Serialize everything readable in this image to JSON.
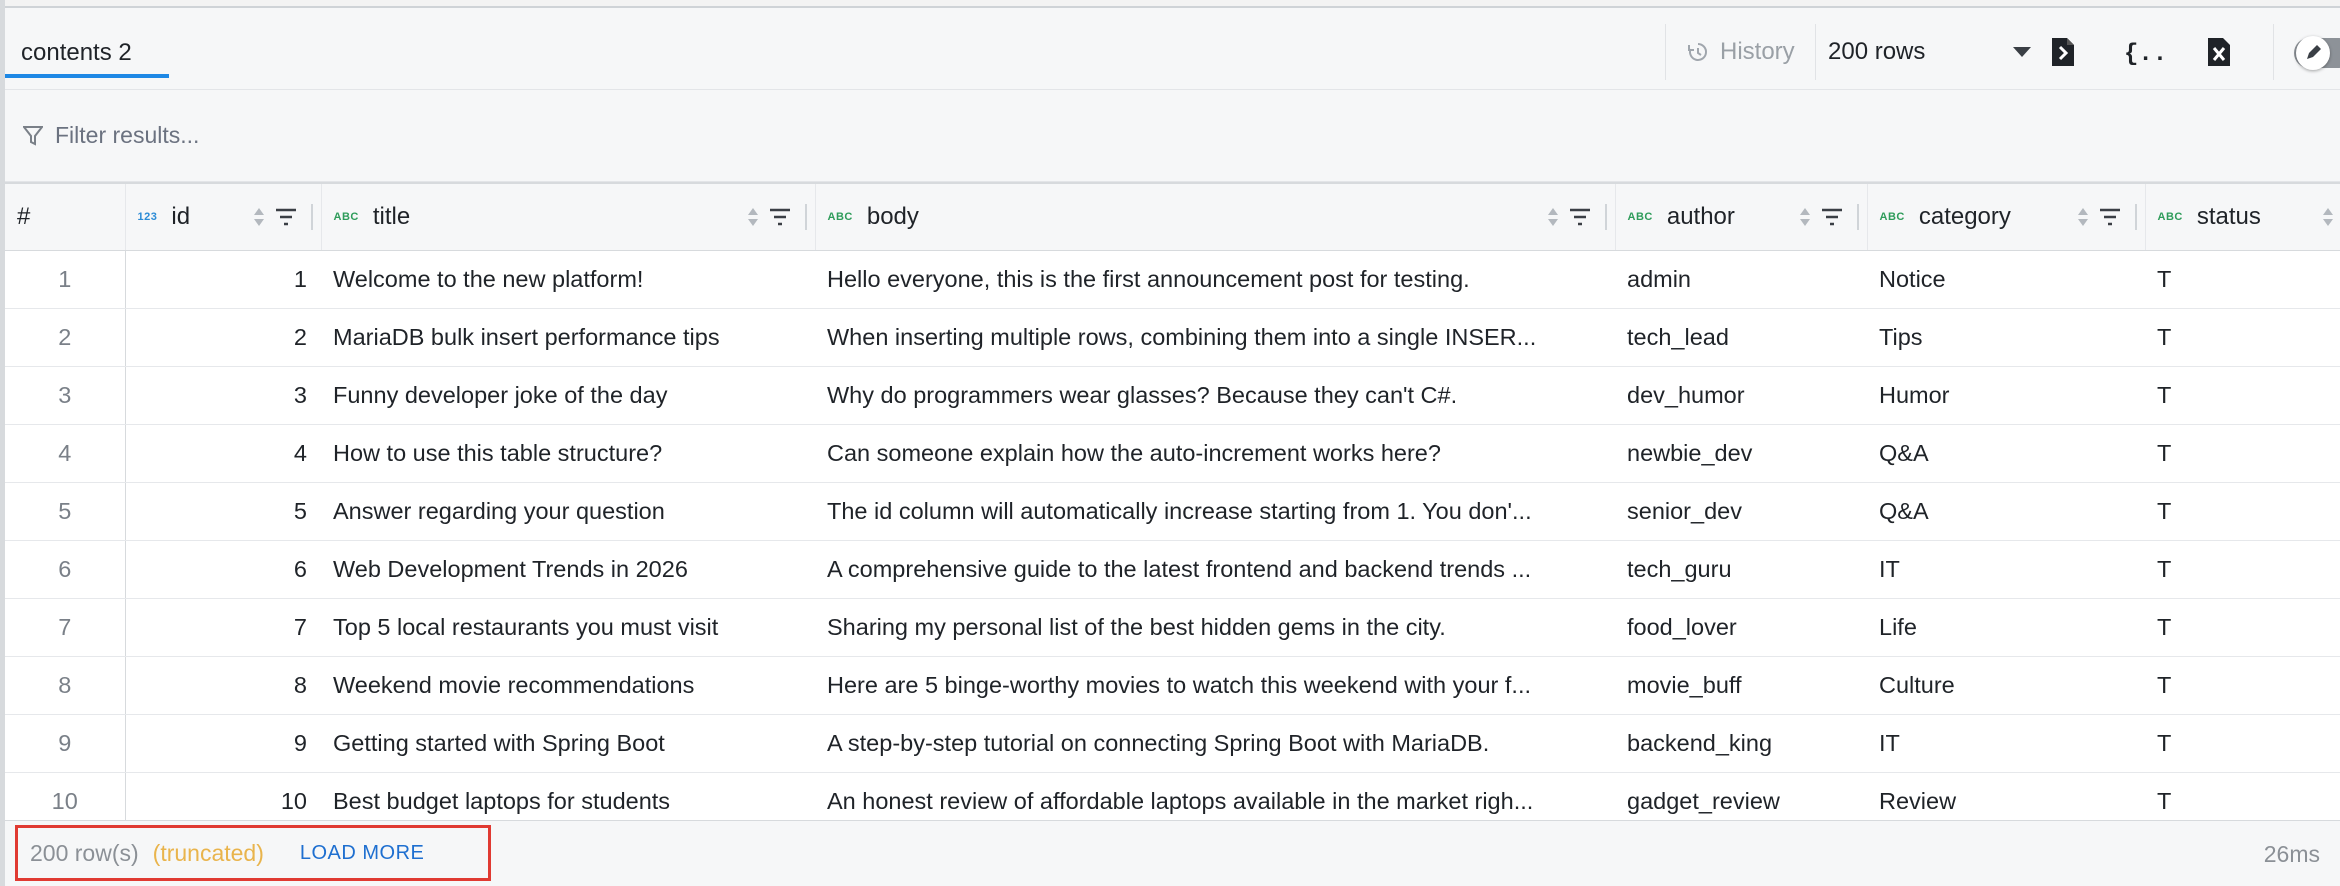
{
  "tab": {
    "label": "contents 2"
  },
  "toolbar": {
    "history_label": "History",
    "rows_selected": "200 rows",
    "icons": [
      "export-file-icon",
      "json-braces-icon",
      "excel-file-icon"
    ],
    "edit_toggle_icon": "pencil-icon"
  },
  "filter": {
    "placeholder": "Filter results..."
  },
  "table": {
    "rownum_header": "#",
    "columns": [
      {
        "name": "id",
        "type": "123"
      },
      {
        "name": "title",
        "type": "ABC"
      },
      {
        "name": "body",
        "type": "ABC"
      },
      {
        "name": "author",
        "type": "ABC"
      },
      {
        "name": "category",
        "type": "ABC"
      },
      {
        "name": "status",
        "type": "ABC"
      }
    ],
    "rows": [
      {
        "n": "1",
        "id": "1",
        "title": "Welcome to the new platform!",
        "body": "Hello everyone, this is the first announcement post for testing.",
        "author": "admin",
        "category": "Notice",
        "status": "T"
      },
      {
        "n": "2",
        "id": "2",
        "title": "MariaDB bulk insert performance tips",
        "body": "When inserting multiple rows, combining them into a single INSER...",
        "author": "tech_lead",
        "category": "Tips",
        "status": "T"
      },
      {
        "n": "3",
        "id": "3",
        "title": "Funny developer joke of the day",
        "body": "Why do programmers wear glasses? Because they can't C#.",
        "author": "dev_humor",
        "category": "Humor",
        "status": "T"
      },
      {
        "n": "4",
        "id": "4",
        "title": "How to use this table structure?",
        "body": "Can someone explain how the auto-increment works here?",
        "author": "newbie_dev",
        "category": "Q&A",
        "status": "T"
      },
      {
        "n": "5",
        "id": "5",
        "title": "Answer regarding your question",
        "body": "The id column will automatically increase starting from 1. You don'...",
        "author": "senior_dev",
        "category": "Q&A",
        "status": "T"
      },
      {
        "n": "6",
        "id": "6",
        "title": "Web Development Trends in 2026",
        "body": "A comprehensive guide to the latest frontend and backend trends ...",
        "author": "tech_guru",
        "category": "IT",
        "status": "T"
      },
      {
        "n": "7",
        "id": "7",
        "title": "Top 5 local restaurants you must visit",
        "body": "Sharing my personal list of the best hidden gems in the city.",
        "author": "food_lover",
        "category": "Life",
        "status": "T"
      },
      {
        "n": "8",
        "id": "8",
        "title": "Weekend movie recommendations",
        "body": "Here are 5 binge-worthy movies to watch this weekend with your f...",
        "author": "movie_buff",
        "category": "Culture",
        "status": "T"
      },
      {
        "n": "9",
        "id": "9",
        "title": "Getting started with Spring Boot",
        "body": "A step-by-step tutorial on connecting Spring Boot with MariaDB.",
        "author": "backend_king",
        "category": "IT",
        "status": "T"
      },
      {
        "n": "10",
        "id": "10",
        "title": "Best budget laptops for students",
        "body": "An honest review of affordable laptops available in the market righ...",
        "author": "gadget_review",
        "category": "Review",
        "status": "T"
      }
    ]
  },
  "footer": {
    "row_count": "200 row(s)",
    "truncated": "(truncated)",
    "load_more": "LOAD MORE",
    "elapsed": "26ms"
  },
  "colors": {
    "accent": "#1e88e5",
    "highlight_border": "#e03a32",
    "truncated": "#e9b44c",
    "link": "#1e6fd0"
  }
}
